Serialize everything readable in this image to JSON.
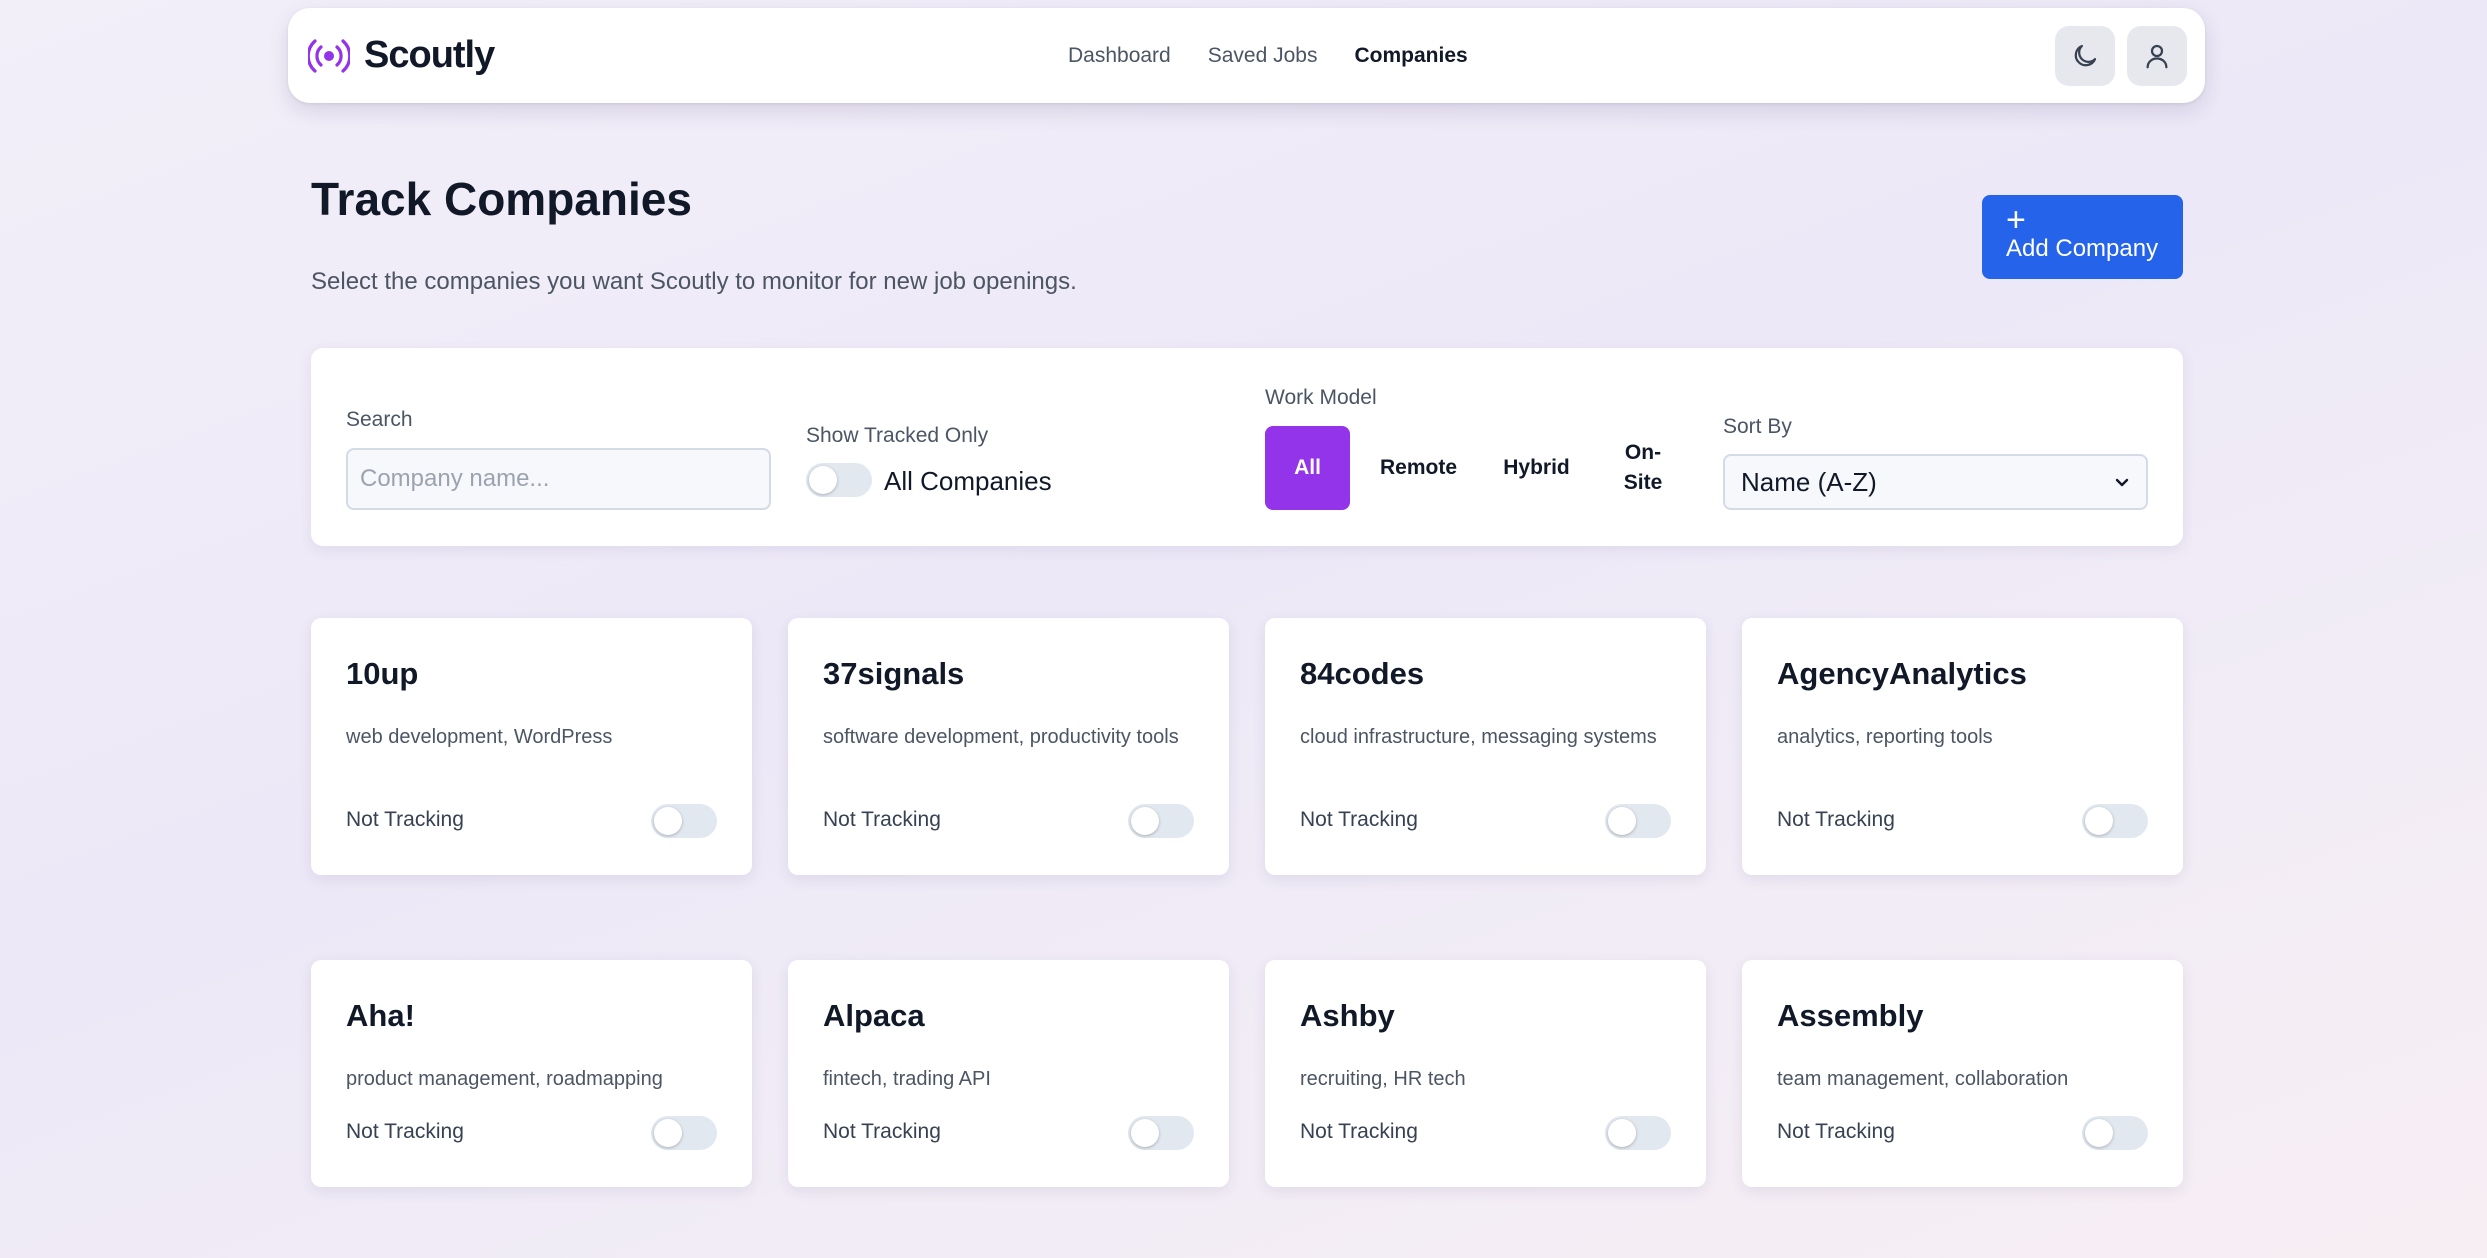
{
  "app": {
    "name": "Scoutly",
    "accent": "#9333ea",
    "primary": "#2563eb"
  },
  "nav": {
    "links": [
      {
        "label": "Dashboard",
        "active": false
      },
      {
        "label": "Saved Jobs",
        "active": false
      },
      {
        "label": "Companies",
        "active": true
      }
    ],
    "actions": {
      "theme_icon": "moon-icon",
      "profile_icon": "user-icon"
    }
  },
  "page": {
    "title": "Track Companies",
    "subtitle": "Select the companies you want Scoutly to monitor for new job openings.",
    "add_button": {
      "icon": "+",
      "label": "Add Company"
    }
  },
  "filters": {
    "search": {
      "label": "Search",
      "placeholder": "Company name...",
      "value": ""
    },
    "tracked_only": {
      "label": "Show Tracked Only",
      "value_label": "All Companies",
      "on": false
    },
    "work_model": {
      "label": "Work Model",
      "options": [
        "All",
        "Remote",
        "Hybrid",
        "On-Site"
      ],
      "selected": "All"
    },
    "sort": {
      "label": "Sort By",
      "value": "Name (A-Z)"
    }
  },
  "companies": [
    {
      "name": "10up",
      "tags": "web development, WordPress",
      "status": "Not Tracking",
      "tracking": false
    },
    {
      "name": "37signals",
      "tags": "software development, productivity tools",
      "status": "Not Tracking",
      "tracking": false
    },
    {
      "name": "84codes",
      "tags": "cloud infrastructure, messaging systems",
      "status": "Not Tracking",
      "tracking": false
    },
    {
      "name": "AgencyAnalytics",
      "tags": "analytics, reporting tools",
      "status": "Not Tracking",
      "tracking": false
    },
    {
      "name": "Aha!",
      "tags": "product management, roadmapping",
      "status": "Not Tracking",
      "tracking": false
    },
    {
      "name": "Alpaca",
      "tags": "fintech, trading API",
      "status": "Not Tracking",
      "tracking": false
    },
    {
      "name": "Ashby",
      "tags": "recruiting, HR tech",
      "status": "Not Tracking",
      "tracking": false
    },
    {
      "name": "Assembly",
      "tags": "team management, collaboration",
      "status": "Not Tracking",
      "tracking": false
    }
  ]
}
